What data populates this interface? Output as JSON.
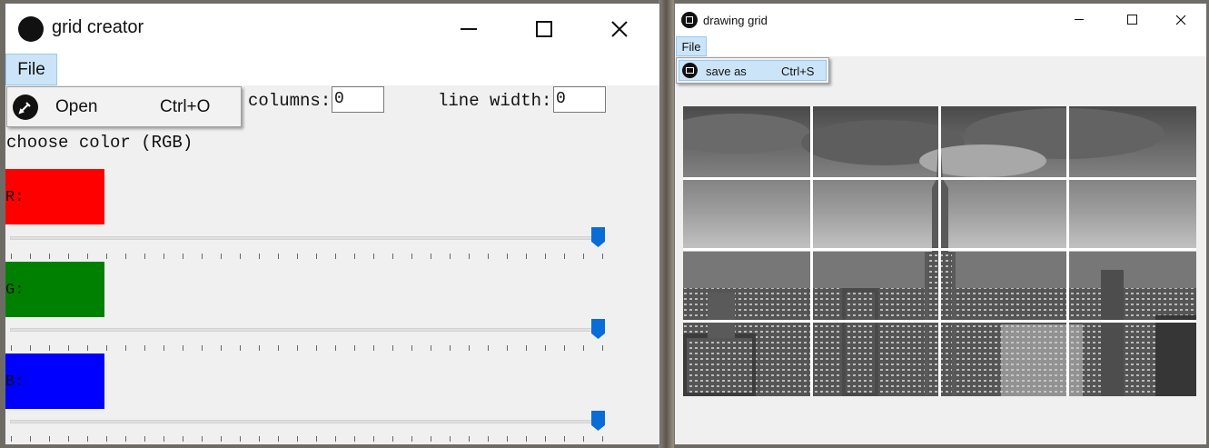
{
  "grid_creator": {
    "title": "grid creator",
    "menu": {
      "file_label": "File"
    },
    "dropdown": {
      "open_label": "Open",
      "open_shortcut": "Ctrl+O"
    },
    "columns_label": "columns:",
    "columns_value": "0",
    "line_width_label": "line width:",
    "line_width_value": "0",
    "choose_color_label": "choose color (RGB)",
    "channels": [
      {
        "label": "R:",
        "color": "#ff0000",
        "slider_value": 255
      },
      {
        "label": "G:",
        "color": "#008000",
        "slider_value": 255
      },
      {
        "label": "B:",
        "color": "#0000ff",
        "slider_value": 255
      }
    ],
    "slider_range": [
      0,
      255
    ]
  },
  "drawing_grid": {
    "title": "drawing grid",
    "menu": {
      "file_label": "File"
    },
    "dropdown": {
      "save_label": "save as",
      "save_shortcut": "Ctrl+S"
    },
    "image": {
      "rows": 4,
      "columns": 4,
      "grid_color": "#ffffff"
    }
  },
  "icons": {
    "minimize": "minimize-icon",
    "maximize": "maximize-icon",
    "close": "close-icon",
    "open": "pencil-icon",
    "save": "save-icon"
  }
}
